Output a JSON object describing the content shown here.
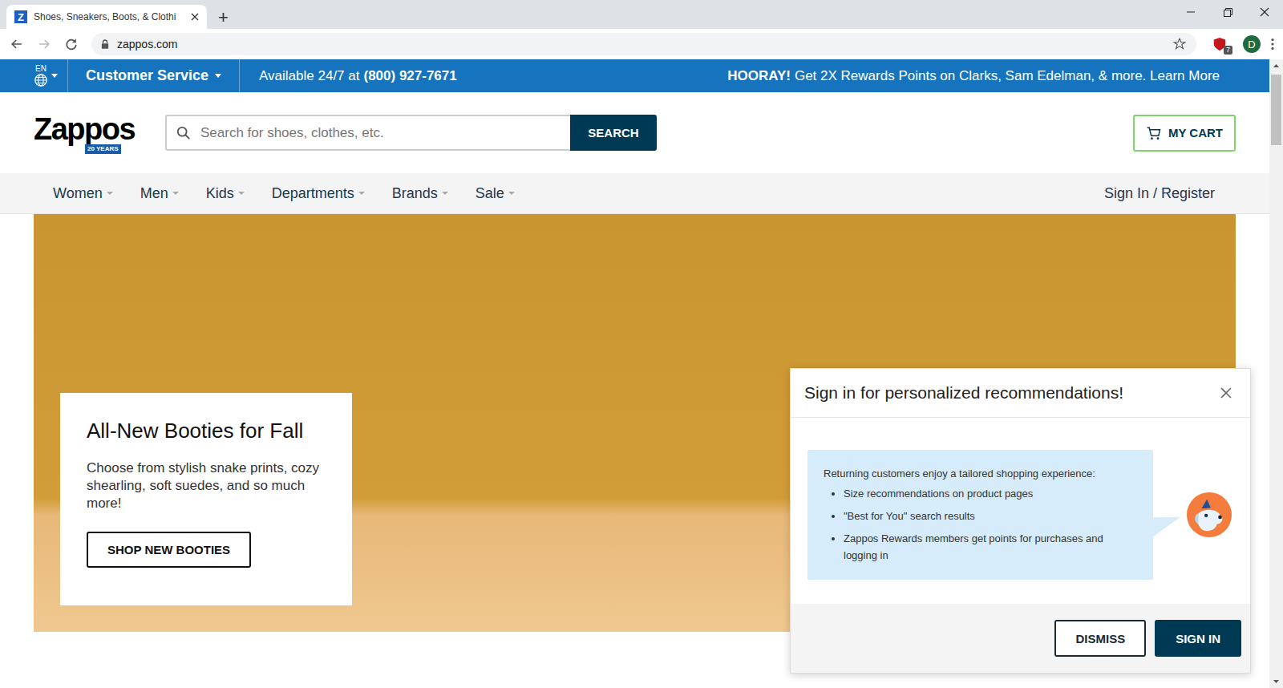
{
  "browser": {
    "tab": {
      "favicon": "Z",
      "title": "Shoes, Sneakers, Boots, & Clothi",
      "selected": true
    },
    "new_tab": "+",
    "url": "zappos.com",
    "extension_badge": "7",
    "profile": "D"
  },
  "top_bar": {
    "language": "EN",
    "customer_service": "Customer Service",
    "availability": "Available 24/7 at",
    "phone": "(800) 927-7671",
    "promo_bold": "HOORAY!",
    "promo": "Get 2X Rewards Points on Clarks, Sam Edelman, & more. Learn More"
  },
  "header": {
    "logo": "Zappos",
    "logo_badge": "20 YEARS",
    "search": {
      "placeholder": "Search for shoes, clothes, etc.",
      "button": "SEARCH"
    },
    "cart": "MY CART"
  },
  "nav": {
    "items": [
      "Women",
      "Men",
      "Kids",
      "Departments",
      "Brands",
      "Sale"
    ],
    "account": "Sign In / Register"
  },
  "hero": {
    "title": "All-New Booties for Fall",
    "text": "Choose from stylish snake prints, cozy shearling, soft suedes, and so much more!",
    "button": "SHOP NEW BOOTIES"
  },
  "popup": {
    "title": "Sign in for personalized recommendations!",
    "intro": "Returning customers enjoy a tailored shopping experience:",
    "bullets": [
      "Size recommendations on product pages",
      "\"Best for You\" search results",
      "Zappos Rewards members get points for purchases and logging in"
    ],
    "buttons": [
      {
        "label": "DISMISS",
        "kind": "secondary"
      },
      {
        "label": "SIGN IN",
        "kind": "primary"
      }
    ]
  }
}
